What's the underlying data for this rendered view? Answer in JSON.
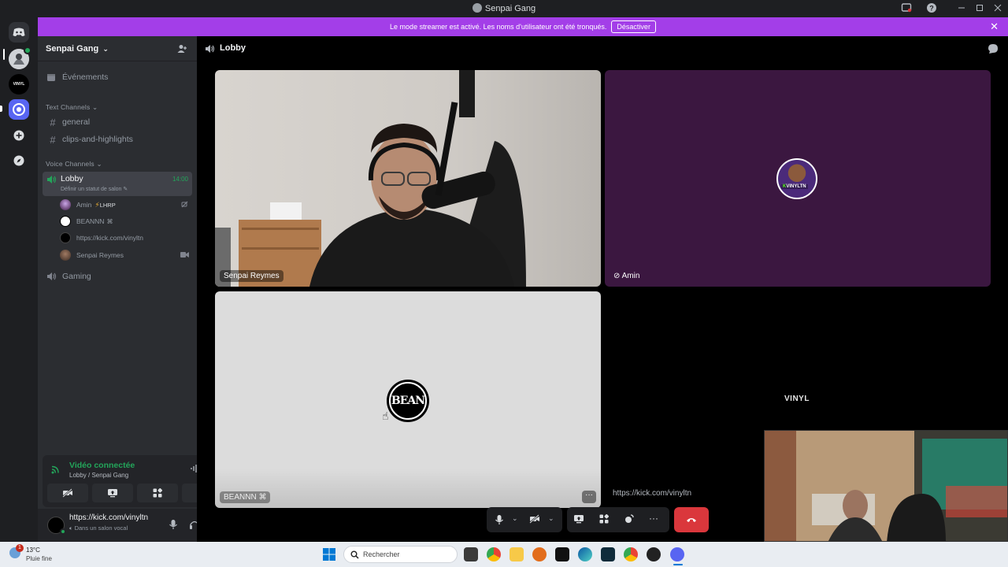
{
  "window": {
    "title": "Senpai Gang"
  },
  "banner": {
    "text": "Le mode streamer est activé. Les noms d'utilisateur ont été tronqués.",
    "button": "Désactiver"
  },
  "server": {
    "name": "Senpai Gang"
  },
  "sidebar": {
    "events": "Événements",
    "text_category": "Text Channels",
    "text_channels": [
      "general",
      "clips-and-highlights"
    ],
    "voice_category": "Voice Channels",
    "lobby": {
      "name": "Lobby",
      "time": "14:00",
      "status": "Définir un statut de salon"
    },
    "voice_users": [
      {
        "name": "Amin",
        "tag": "LHRP"
      },
      {
        "name": "BEANNN",
        "tag": ""
      },
      {
        "name": "https://kick.com/vinyltn",
        "tag": ""
      },
      {
        "name": "Senpai Reymes",
        "tag": ""
      }
    ],
    "gaming": "Gaming"
  },
  "voice_status": {
    "title": "Vidéo connectée",
    "subtitle": "Lobby / Senpai Gang"
  },
  "user_panel": {
    "name": "https://kick.com/vinyltn",
    "status": "Dans un salon vocal"
  },
  "main": {
    "channel": "Lobby",
    "tiles": {
      "senpai": "Senpai Reymes",
      "amin": "Amin",
      "beannn": "BEANNN",
      "vinyl_logo": "VINYL",
      "vinyl_name": "https://kick.com/vinyltn"
    },
    "amin_avatar_text": "VINYLTN",
    "beannn_logo": "BEAN"
  },
  "taskbar": {
    "weather_temp": "13°C",
    "weather_desc": "Pluie fine",
    "search_placeholder": "Rechercher",
    "badge": "1"
  },
  "colors": {
    "accent": "#a33ee8",
    "connected_green": "#23a55a",
    "hangup_red": "#da373c",
    "amin_tile": "#3b1740"
  }
}
